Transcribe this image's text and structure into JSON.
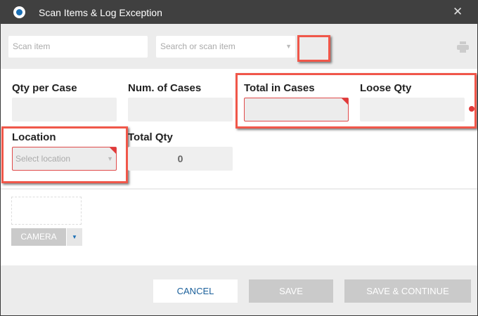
{
  "window": {
    "title": "Scan Items & Log Exception"
  },
  "toolbar": {
    "scan_placeholder": "Scan item",
    "search_placeholder": "Search or scan item"
  },
  "fields": {
    "qty_per_case": {
      "label": "Qty per Case",
      "value": ""
    },
    "num_cases": {
      "label": "Num. of Cases",
      "value": ""
    },
    "total_in_cases": {
      "label": "Total in Cases",
      "value": ""
    },
    "loose_qty": {
      "label": "Loose Qty",
      "value": ""
    },
    "location": {
      "label": "Location",
      "placeholder": "Select location"
    },
    "total_qty": {
      "label": "Total Qty",
      "value": "0"
    }
  },
  "camera": {
    "label": "CAMERA"
  },
  "footer": {
    "cancel": "CANCEL",
    "save": "SAVE",
    "save_continue": "SAVE & CONTINUE"
  },
  "colors": {
    "accent": "#1a6fb5",
    "highlight": "#f0574a",
    "error": "#e03a3a"
  }
}
